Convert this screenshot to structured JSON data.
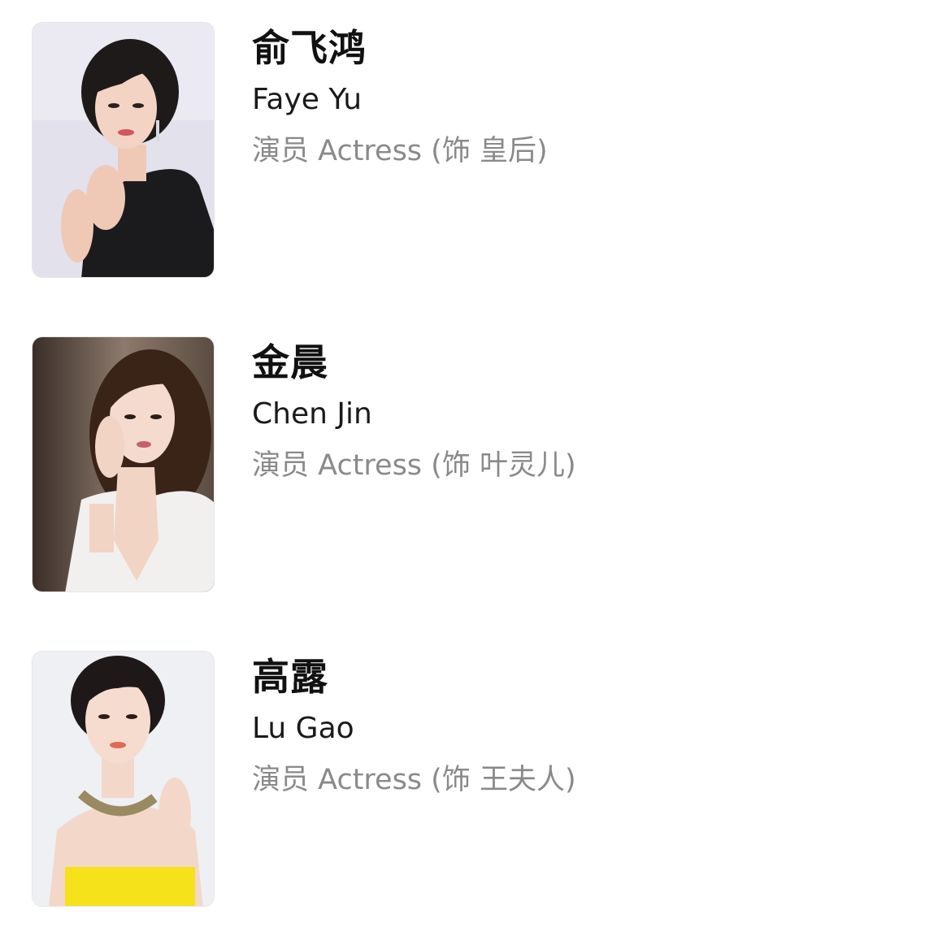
{
  "cast": [
    {
      "name_cn": "俞飞鸿",
      "name_en": "Faye Yu",
      "role": "演员 Actress (饰 皇后)"
    },
    {
      "name_cn": "金晨",
      "name_en": "Chen Jin",
      "role": "演员 Actress (饰 叶灵儿)"
    },
    {
      "name_cn": "高露",
      "name_en": "Lu Gao",
      "role": "演员 Actress (饰 王夫人)"
    }
  ]
}
